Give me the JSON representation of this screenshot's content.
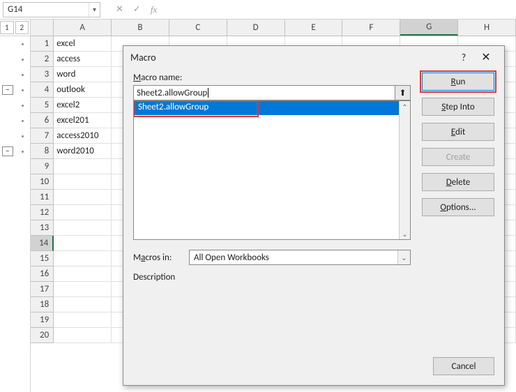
{
  "formula_bar": {
    "name_box": "G14",
    "cancel_icon": "✕",
    "accept_icon": "✓",
    "fx_label": "fx"
  },
  "outline": {
    "levels": [
      "1",
      "2"
    ],
    "collapse_symbol": "–"
  },
  "columns": [
    "A",
    "B",
    "C",
    "D",
    "E",
    "F",
    "G",
    "H"
  ],
  "row_numbers": [
    "1",
    "2",
    "3",
    "4",
    "5",
    "6",
    "7",
    "8",
    "9",
    "10",
    "11",
    "12",
    "13",
    "14",
    "15",
    "16",
    "17",
    "18",
    "19",
    "20"
  ],
  "active_cell": {
    "col": "G",
    "row": "14"
  },
  "data_a": [
    "excel",
    "access",
    "word",
    "outlook",
    "excel2",
    "excel201",
    "access2010",
    "word2010"
  ],
  "dialog": {
    "title": "Macro",
    "help": "?",
    "close": "✕",
    "name_label": "Macro name:",
    "ref_icon": "⬆",
    "name_value": "Sheet2.allowGroup",
    "list_item": "Sheet2.allowGroup",
    "scroll_up": "⌃",
    "scroll_down": "⌄",
    "macros_in_label": "Macros in:",
    "macros_in_value": "All Open Workbooks",
    "select_arrow": "⌄",
    "description_label": "Description",
    "buttons": {
      "run": "Run",
      "run_u": "R",
      "step": "tep Into",
      "step_u": "S",
      "edit": "dit",
      "edit_u": "E",
      "create": "Create",
      "create_u": "C",
      "delete": "elete",
      "delete_u": "D",
      "options": "ptions...",
      "options_u": "O",
      "cancel": "Cancel"
    }
  }
}
